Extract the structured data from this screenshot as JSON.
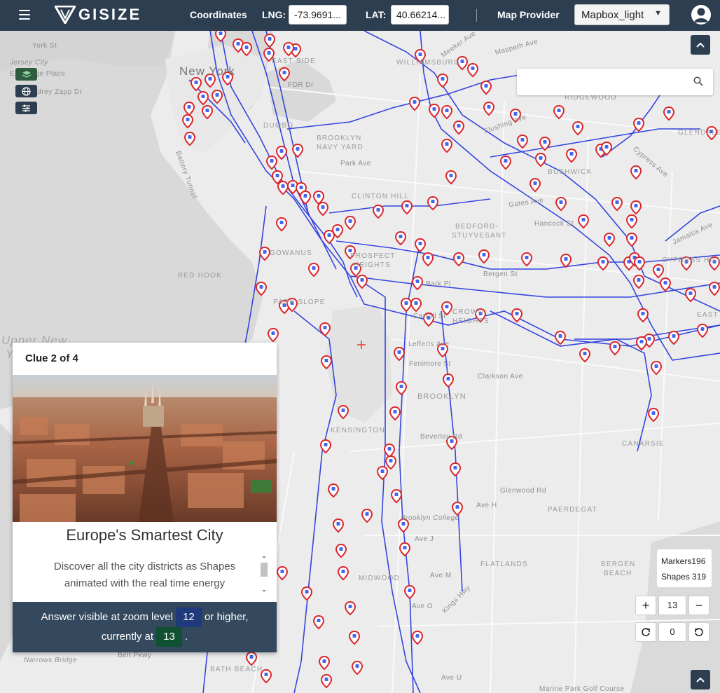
{
  "topbar": {
    "logo_text": "GISIZE",
    "coordinates_label": "Coordinates",
    "lng_label": "LNG:",
    "lng_value": "-73.9691...",
    "lat_label": "LAT:",
    "lat_value": "40.66214...",
    "map_provider_label": "Map Provider",
    "map_provider_value": "Mapbox_light",
    "icons": [
      "menu-icon",
      "user-avatar-icon",
      "chevron-down-icon"
    ]
  },
  "map": {
    "labels": {
      "new_york": "New York",
      "upper_new_york_bay_1": "Upper New",
      "upper_new_york_bay_2": "York",
      "york_st": "York St",
      "jersey_city": "Jersey City",
      "exchange_place": "Exchange Place",
      "audrey_zapp": "Audrey Zapp Dr",
      "east_side": "EAST SIDE",
      "fdr_dr": "FDR Dr",
      "williamsburg": "WILLIAMSBURG",
      "meeker_ave": "Meeker Ave",
      "maspeth_ave": "Maspeth Ave",
      "ridgewood": "RIDGEWOOD",
      "glendale": "GLENDALE",
      "dumbo": "DUMBO",
      "brooklyn_navy_yard_1": "BROOKLYN",
      "brooklyn_navy_yard_2": "NAVY YARD",
      "bushwick": "BUSHWICK",
      "clinton_hill": "CLINTON HILL",
      "bedford_1": "BEDFORD-",
      "bedford_2": "STUYVESANT",
      "red_hook": "RED HOOK",
      "gowanus": "GOWANUS",
      "prospect_1": "PROSPECT",
      "prospect_2": "HEIGHTS",
      "park_slope": "PARK SLOPE",
      "crown_1": "CROWN",
      "crown_2": "HEIGHTS",
      "cypress_hills": "CYPRESS HILLS",
      "east_new_york": "EAST NEW",
      "brooklyn": "BROOKLYN",
      "kensington": "KENSINGTON",
      "canarsie": "CANARSIE",
      "paerdegat": "PAERDEGAT",
      "flatlands": "FLATLANDS",
      "midwood": "MIDWOOD",
      "bergen_beach_1": "BERGEN",
      "bergen_beach_2": "BEACH",
      "bath_beach": "BATH BEACH",
      "narrows_bridge": "Narrows Bridge",
      "brooklyn_college": "Brooklyn College",
      "battery_tunnel": "Battery Tunnel",
      "flushing_ave": "Flushing Ave",
      "gates_ave": "Gates Ave",
      "park_ave": "Park Ave",
      "park_pl": "Park Pl",
      "lefferts_ave": "Lefferts Ave",
      "fenimore_st": "Fenimore St",
      "clarkson_ave": "Clarkson Ave",
      "beverley_rd": "Beverley Rd",
      "glenwood_rd": "Glenwood Rd",
      "ave_h": "Ave H",
      "ave_j": "Ave J",
      "ave_m": "Ave M",
      "ave_o": "Ave O",
      "ave_u": "Ave U",
      "kings_hwy": "Kings Hwy",
      "jamaica_ave": "Jamaica Ave",
      "cypress_ave": "Cypress Ave",
      "belt_pkwy": "Belt Pkwy",
      "marine_park": "Marine Park Golf Course",
      "hancock_st": "Hancock St",
      "bergen_st": "Bergen St",
      "carroll_st": "Carroll St"
    },
    "layers_icon": "layers-icon",
    "globe_icon": "globe-icon",
    "sliders_icon": "sliders-icon",
    "search_placeholder": "",
    "search_icon": "search-icon"
  },
  "clue": {
    "header": "Clue 2 of 4",
    "title": "Europe's Smartest City",
    "description": "Discover all the city districts as Shapes animated with the real time energy",
    "footer_prefix": "Answer visible at zoom level",
    "required_zoom": "12",
    "footer_mid": "or higher,",
    "footer_current_prefix": "currently at",
    "current_zoom": "13",
    "footer_suffix": ".",
    "colors": {
      "required_badge": "#1f3a7a",
      "current_badge": "#0f5132"
    }
  },
  "stats": {
    "markers_label": "Markers",
    "markers_value": "196",
    "shapes_label": "Shapes",
    "shapes_value": "319"
  },
  "zoom": {
    "plus": "+",
    "minus": "−",
    "level": "13",
    "rotation": "0"
  },
  "colors": {
    "topbar": "#2c3e50",
    "route": "#2233dd",
    "marker": "#d9262c"
  }
}
